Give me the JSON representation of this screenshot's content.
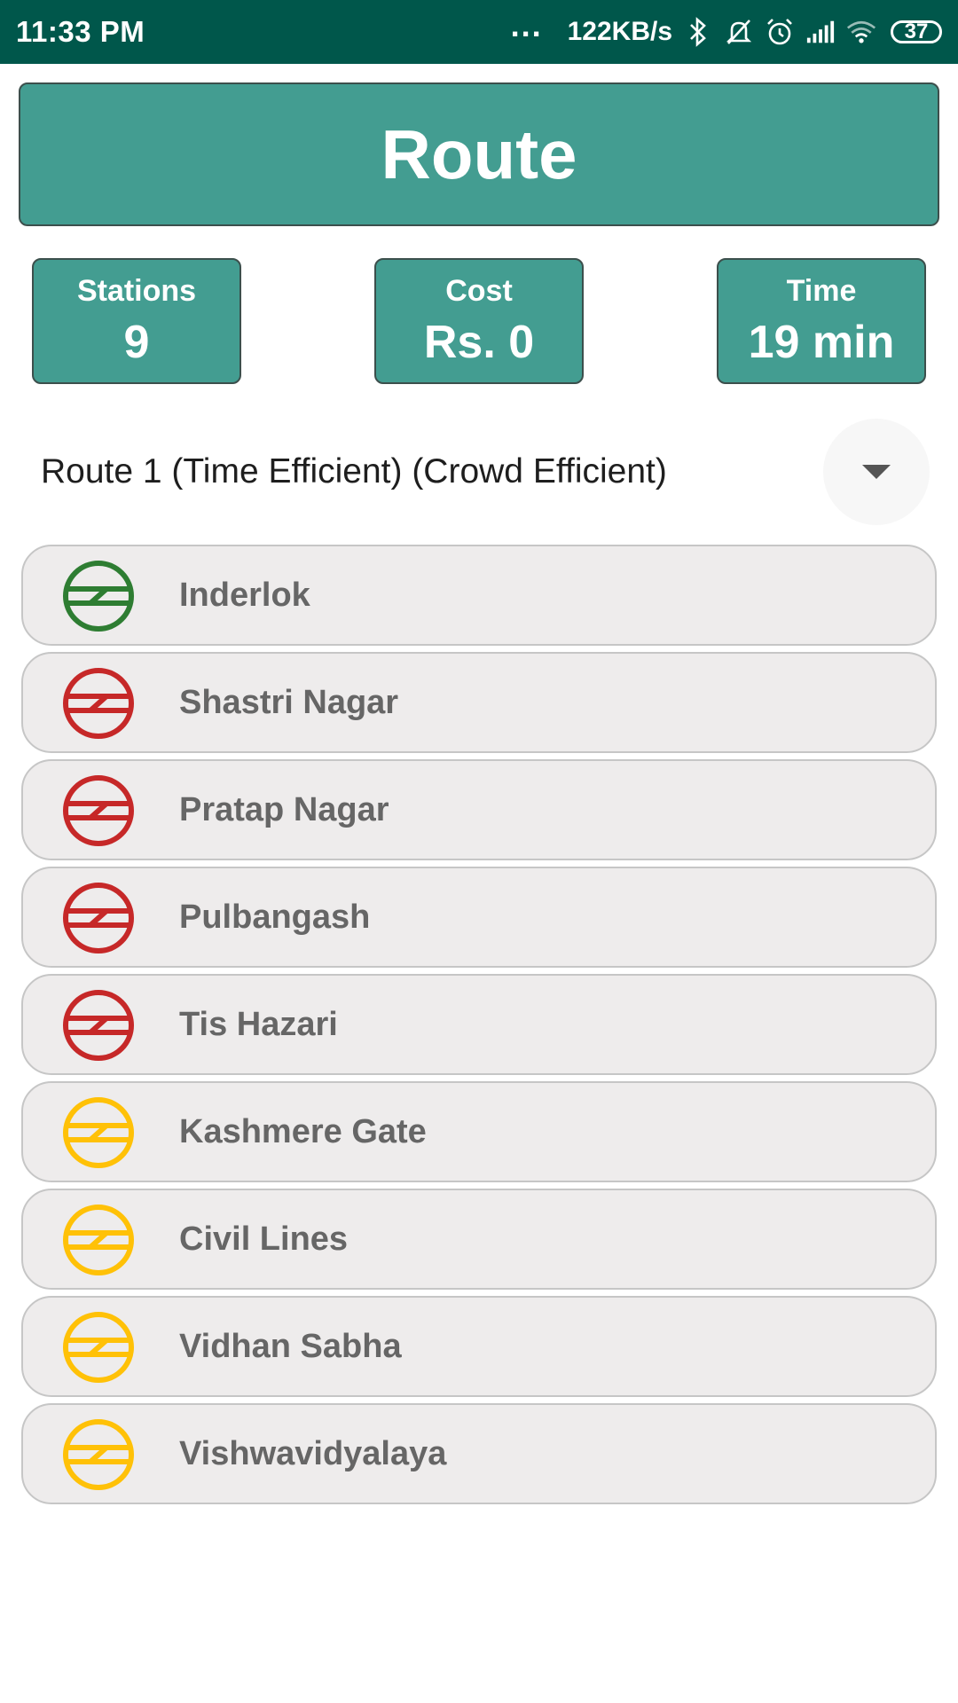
{
  "status_bar": {
    "time": "11:33 PM",
    "dots": "...",
    "speed": "122KB/s",
    "battery": "37",
    "icons": [
      "bluetooth-icon",
      "mute-icon",
      "alarm-icon",
      "signal-icon",
      "wifi-icon",
      "battery-icon"
    ]
  },
  "header": {
    "title": "Route"
  },
  "stats": {
    "stations": {
      "label": "Stations",
      "value": "9"
    },
    "cost": {
      "label": "Cost",
      "value": "Rs. 0"
    },
    "time": {
      "label": "Time",
      "value": "19 min"
    }
  },
  "route_select": {
    "selected": "Route 1 (Time Efficient) (Crowd Efficient)",
    "icon": "dropdown-arrow-icon"
  },
  "colors": {
    "header_bg": "#439d91",
    "status_bar_bg": "#00574b",
    "green_line": "#2e7d32",
    "red_line": "#c62828",
    "yellow_line": "#ffc107"
  },
  "stations": [
    {
      "name": "Inderlok",
      "line_color": "#2e7d32",
      "icon": "metro-logo-icon"
    },
    {
      "name": "Shastri Nagar",
      "line_color": "#c62828",
      "icon": "metro-logo-icon"
    },
    {
      "name": "Pratap Nagar",
      "line_color": "#c62828",
      "icon": "metro-logo-icon"
    },
    {
      "name": "Pulbangash",
      "line_color": "#c62828",
      "icon": "metro-logo-icon"
    },
    {
      "name": "Tis Hazari",
      "line_color": "#c62828",
      "icon": "metro-logo-icon"
    },
    {
      "name": "Kashmere Gate",
      "line_color": "#ffc107",
      "icon": "metro-logo-icon"
    },
    {
      "name": "Civil Lines",
      "line_color": "#ffc107",
      "icon": "metro-logo-icon"
    },
    {
      "name": "Vidhan Sabha",
      "line_color": "#ffc107",
      "icon": "metro-logo-icon"
    },
    {
      "name": "Vishwavidyalaya",
      "line_color": "#ffc107",
      "icon": "metro-logo-icon"
    }
  ]
}
